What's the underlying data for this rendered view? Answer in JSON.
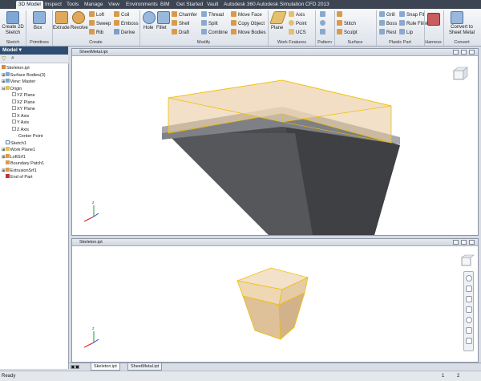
{
  "tabs": [
    "3D Model",
    "Inspect",
    "Tools",
    "Manage",
    "View",
    "Environments",
    "BIM",
    "Get Started",
    "Vault",
    "Autodesk 360",
    "Autodesk Simulation CFD 2013"
  ],
  "ribbon": {
    "sketch": {
      "create_2d_sketch": "Create 2D Sketch",
      "group": "Sketch"
    },
    "primitives": {
      "box": "Box",
      "group": "Primitives"
    },
    "create": {
      "extrude": "Extrude",
      "revolve": "Revolve",
      "loft": "Loft",
      "sweep": "Sweep",
      "rib": "Rib",
      "coil": "Coil",
      "emboss": "Emboss",
      "derive": "Derive",
      "group": "Create"
    },
    "modify": {
      "hole": "Hole",
      "fillet": "Fillet",
      "chamfer": "Chamfer",
      "shell": "Shell",
      "draft": "Draft",
      "thread": "Thread",
      "split": "Split",
      "combine": "Combine",
      "move_face": "Move Face",
      "copy_object": "Copy Object",
      "move_bodies": "Move Bodies",
      "group": "Modify"
    },
    "work_features": {
      "plane": "Plane",
      "axis": "Axis",
      "point": "Point",
      "ucs": "UCS",
      "group": "Work Features"
    },
    "pattern": {
      "group": "Pattern"
    },
    "surface": {
      "stitch": "Stitch",
      "sculpt": "Sculpt",
      "group": "Surface"
    },
    "plastic_part": {
      "grill": "Grill",
      "boss": "Boss",
      "rest": "Rest",
      "snap_fit": "Snap Fit",
      "rule_fillet": "Rule Fillet",
      "lip": "Lip",
      "group": "Plastic Part"
    },
    "harness": {
      "group": "Harness"
    },
    "convert": {
      "convert_to_sheet_metal": "Convert to Sheet Metal",
      "group": "Convert"
    }
  },
  "browser": {
    "title": "Model",
    "items": [
      "Skeleton.ipt",
      "Surface Bodies(3)",
      "View: Master",
      "Origin",
      "YZ Plane",
      "XZ Plane",
      "XY Plane",
      "X Axis",
      "Y Axis",
      "Z Axis",
      "Center Point",
      "Sketch1",
      "Work Plane1",
      "LoftSrf1",
      "Boundary Patch1",
      "ExtrusionSrf1",
      "End of Part"
    ]
  },
  "views": {
    "top_title": "SheetMetal.ipt",
    "bottom_title": "Skeleton.ipt"
  },
  "doc_tabs": [
    "Skeleton.ipt",
    "SheetMetal.ipt"
  ],
  "status": {
    "text": "Ready",
    "count1": "1",
    "count2": "2"
  },
  "colors": {
    "accent": "#2f4d72",
    "surface_fill": "#e8c99a",
    "surface_edge": "#f0c000",
    "body_gray": "#4b4d51"
  }
}
